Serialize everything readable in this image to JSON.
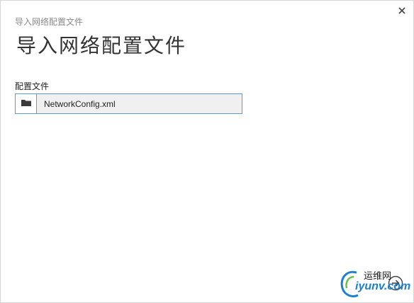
{
  "dialog": {
    "breadcrumb": "导入网络配置文件",
    "title": "导入网络配置文件",
    "close_icon": "close-icon"
  },
  "form": {
    "field_label": "配置文件",
    "browse_icon": "folder-icon",
    "file_name": "NetworkConfig.xml"
  },
  "footer": {
    "next_icon": "arrow-right-circle-icon"
  },
  "watermark": {
    "top_text": "运维网",
    "bottom_text": "iyunv.com"
  },
  "colors": {
    "accent": "#5b9bd5",
    "field_bg": "#f0f0f0",
    "watermark_blue": "#1c7fd1"
  }
}
